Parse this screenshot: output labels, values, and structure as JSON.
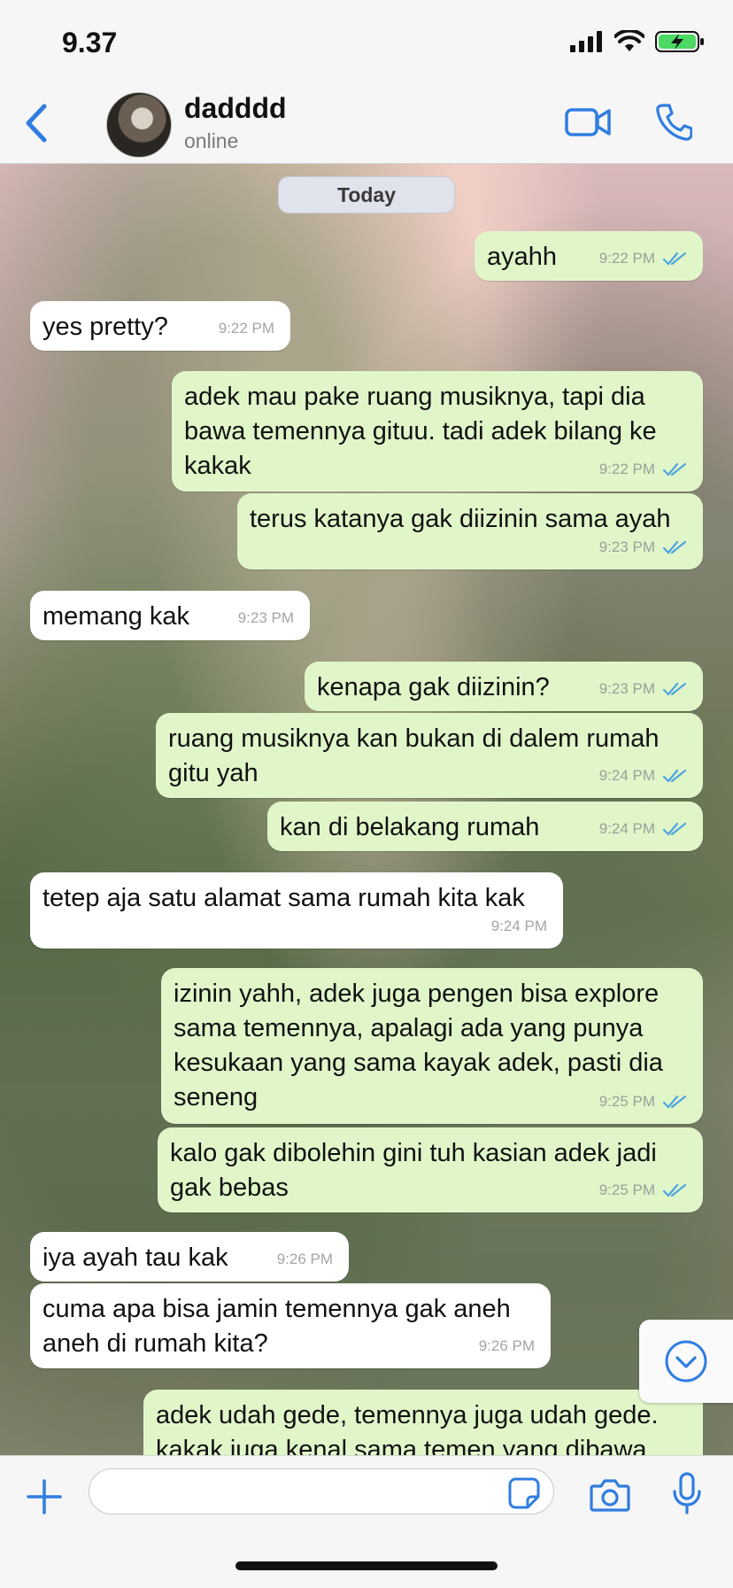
{
  "status_bar": {
    "time": "9.37"
  },
  "header": {
    "name": "dadddd",
    "status": "online"
  },
  "chat": {
    "date_label": "Today",
    "messages": [
      {
        "dir": "out",
        "text": "ayahh",
        "time": "9:22 PM"
      },
      {
        "dir": "in",
        "text": "yes pretty?",
        "time": "9:22 PM"
      },
      {
        "dir": "out",
        "text": "adek mau pake ruang musiknya, tapi dia bawa temennya gituu. tadi adek bilang ke kakak",
        "time": "9:22 PM"
      },
      {
        "dir": "out",
        "text": "terus katanya gak diizinin sama ayah",
        "time": "9:23 PM"
      },
      {
        "dir": "in",
        "text": "memang kak",
        "time": "9:23 PM"
      },
      {
        "dir": "out",
        "text": "kenapa gak diizinin?",
        "time": "9:23 PM"
      },
      {
        "dir": "out",
        "text": "ruang musiknya kan bukan di dalem rumah gitu yah",
        "time": "9:24 PM"
      },
      {
        "dir": "out",
        "text": "kan di belakang rumah",
        "time": "9:24 PM"
      },
      {
        "dir": "in",
        "text": "tetep aja satu alamat sama rumah kita kak",
        "time": "9:24 PM"
      },
      {
        "dir": "out",
        "text": "izinin yahh, adek juga pengen bisa explore sama temennya, apalagi ada yang punya kesukaan yang sama kayak adek, pasti dia seneng",
        "time": "9:25 PM"
      },
      {
        "dir": "out",
        "text": "kalo gak dibolehin gini tuh kasian adek jadi gak bebas",
        "time": "9:25 PM"
      },
      {
        "dir": "in",
        "text": "iya ayah tau kak",
        "time": "9:26 PM"
      },
      {
        "dir": "in",
        "text": "cuma apa bisa jamin temennya gak aneh aneh di rumah kita?",
        "time": "9:26 PM"
      },
      {
        "dir": "out",
        "text": "adek udah gede, temennya juga udah gede. kakak juga kenal sama temen yang dibawa",
        "time": ""
      }
    ]
  },
  "input": {
    "placeholder": ""
  },
  "colors": {
    "accent": "#2f7de1",
    "outgoing_bubble": "#e0f6c9",
    "incoming_bubble": "#ffffff",
    "tick": "#4fa3e0"
  }
}
